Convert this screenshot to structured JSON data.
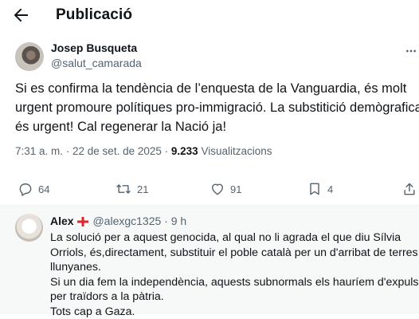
{
  "header": {
    "title": "Publicació"
  },
  "post": {
    "author_name": "Josep Busqueta",
    "author_handle": "@salut_camarada",
    "text_lines": [
      "Si es confirma la tendència de l’enquesta de la Vanguardia, és molt",
      "urgent promoure polítiques pro-immigració. La substitició demògrafica",
      "és urgent! Cal regenerar la Nació ja!"
    ],
    "timestamp": "7:31 a. m. · 22 de set. de 2025 ·",
    "views_count": "9.233",
    "views_label": "Visualitzacions",
    "actions": {
      "replies": "64",
      "reposts": "21",
      "likes": "91",
      "bookmarks": "4"
    }
  },
  "reply": {
    "author_name": "Alex",
    "author_flag": "St George's cross flag",
    "author_handle_time": "@alexgc1325 · 9 h",
    "text_lines": [
      "La solució per a aquest genocida, al qual no li agrada el que diu Sílvia",
      "Orriols, és,directament, substituir el poble català per un d'arribat de terres",
      "llunyanes.",
      "Si un dia fem la independència, aquests subnormals els hauríem d'expulsar",
      "per traïdors a la pàtria.",
      "Tots cap a Gaza."
    ]
  },
  "icons": {
    "back": "arrow-left-icon",
    "more": "more-dots-icon",
    "reply": "reply-bubble-icon",
    "repost": "repost-icon",
    "like": "heart-icon",
    "bookmark": "bookmark-icon",
    "share": "share-icon"
  },
  "colors": {
    "text": "#0f1419",
    "secondary": "#536471",
    "reply_background": "#f7f9f9",
    "flag_red": "#e1242a"
  }
}
